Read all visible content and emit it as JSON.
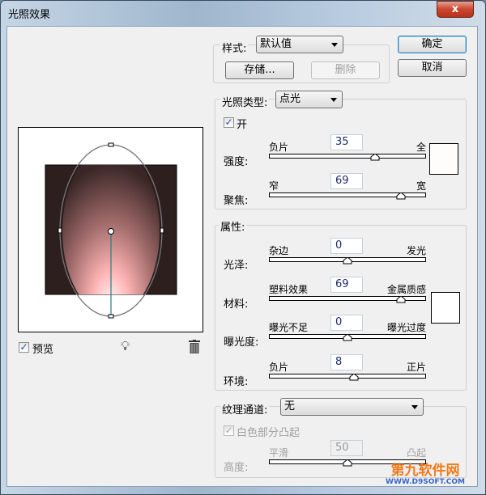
{
  "window": {
    "title": "光照效果",
    "close": "x"
  },
  "style_group": {
    "label": "样式:",
    "preset": "默认值",
    "save": "存储...",
    "delete": "删除"
  },
  "buttons": {
    "ok": "确定",
    "cancel": "取消"
  },
  "light_type": {
    "label": "光照类型:",
    "value": "点光",
    "on_label": "开",
    "on": true,
    "intensity": {
      "label": "强度:",
      "left": "负片",
      "right": "全",
      "value": 35,
      "min": -100,
      "max": 100
    },
    "focus": {
      "label": "聚焦:",
      "left": "窄",
      "right": "宽",
      "value": 69,
      "min": -100,
      "max": 100
    },
    "color": "#fffdfb"
  },
  "properties": {
    "label": "属性:",
    "sliders": [
      {
        "label": "光泽:",
        "left": "杂边",
        "right": "发光",
        "value": 0,
        "min": -100,
        "max": 100
      },
      {
        "label": "材料:",
        "left": "塑料效果",
        "right": "金属质感",
        "value": 69,
        "min": -100,
        "max": 100
      },
      {
        "label": "曝光度:",
        "left": "曝光不足",
        "right": "曝光过度",
        "value": 0,
        "min": -100,
        "max": 100
      },
      {
        "label": "环境:",
        "left": "负片",
        "right": "正片",
        "value": 8,
        "min": -100,
        "max": 100
      }
    ],
    "color": "#ffffff"
  },
  "texture": {
    "label": "纹理通道:",
    "value": "无",
    "white_high": "白色部分凸起",
    "height": {
      "label": "高度:",
      "left": "平滑",
      "right": "凸起",
      "value": 50,
      "min": 0,
      "max": 100
    }
  },
  "preview": {
    "label": "预览",
    "checked": true
  },
  "watermark": {
    "name": "第九软件网",
    "url": "WWW.D9SOFT.COM"
  }
}
